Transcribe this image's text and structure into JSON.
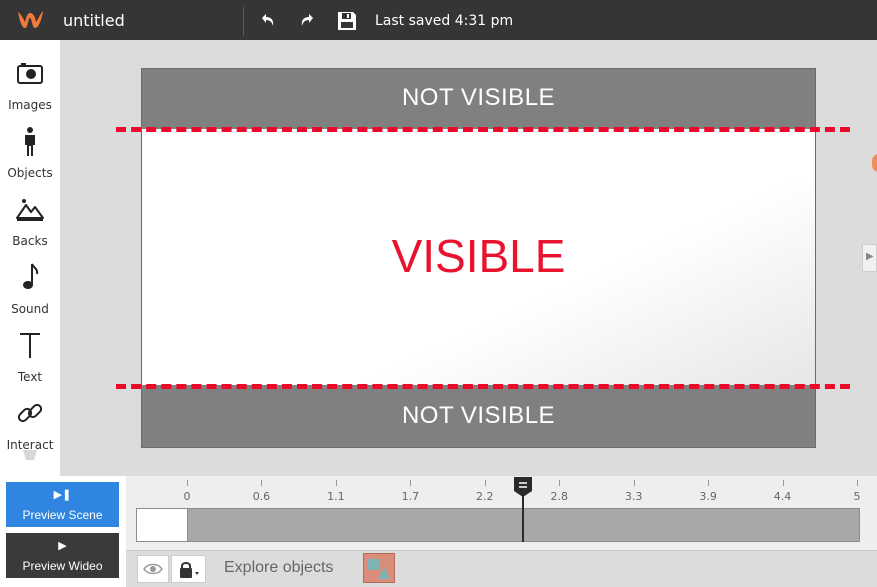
{
  "header": {
    "doc_title": "untitled",
    "last_saved": "Last saved 4:31 pm",
    "logo_icon": "wideo-logo-icon",
    "accent": "#f07a3a"
  },
  "sidebar": {
    "items": [
      {
        "label": "Images",
        "icon": "camera-icon"
      },
      {
        "label": "Objects",
        "icon": "person-icon"
      },
      {
        "label": "Backs",
        "icon": "mountain-icon"
      },
      {
        "label": "Sound",
        "icon": "music-note-icon"
      },
      {
        "label": "Text",
        "icon": "text-t-icon"
      },
      {
        "label": "Interact",
        "icon": "link-icon"
      }
    ]
  },
  "stage": {
    "top_label": "NOT VISIBLE",
    "center_label": "VISIBLE",
    "bottom_label": "NOT VISIBLE",
    "guide_color": "#ec0a2a"
  },
  "preview": {
    "scene_label": "Preview Scene",
    "video_label": "Preview Wideo",
    "scene_color": "#2f85e0"
  },
  "timeline": {
    "ticks": [
      "0",
      "0.6",
      "1.1",
      "1.7",
      "2.2",
      "2.8",
      "3.3",
      "3.9",
      "4.4",
      "5"
    ],
    "playhead_position": 2.5
  },
  "bottom_bar": {
    "explore_label": "Explore objects"
  }
}
